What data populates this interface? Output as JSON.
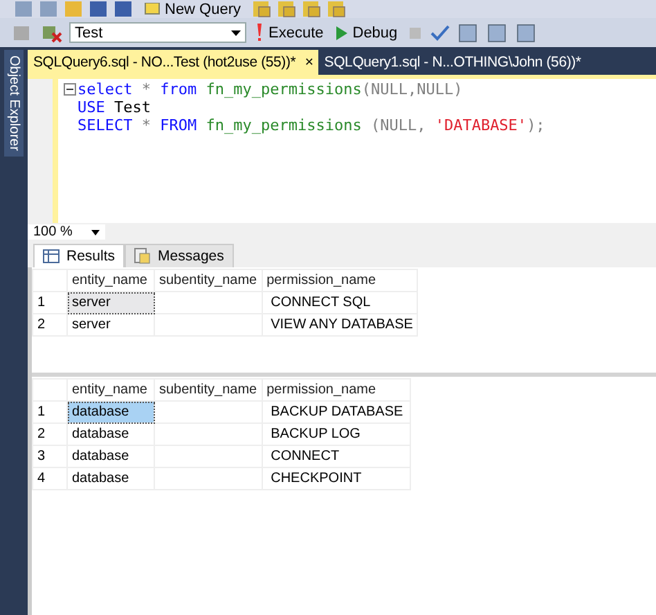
{
  "toolbar_top": {
    "new_query": "New Query"
  },
  "toolbar": {
    "database": "Test",
    "execute": "Execute",
    "debug": "Debug"
  },
  "sidebar": {
    "label": "Object Explorer"
  },
  "tabs": [
    {
      "label": "SQLQuery6.sql - NO...Test (hot2use (55))*",
      "selected": true,
      "close": "×"
    },
    {
      "label": "SQLQuery1.sql - N...OTHING\\John (56))*",
      "selected": false
    }
  ],
  "editor": {
    "lines": [
      [
        {
          "kind": "keyword",
          "text": "select"
        },
        {
          "kind": "operator",
          "text": " * "
        },
        {
          "kind": "keyword",
          "text": "from"
        },
        {
          "kind": "function",
          "text": " fn_my_permissions"
        },
        {
          "kind": "operator",
          "text": "(NULL,NULL)"
        }
      ],
      [
        {
          "kind": "keyword",
          "text": "USE"
        },
        {
          "kind": "plain",
          "text": " Test"
        }
      ],
      [
        {
          "kind": "keyword",
          "text": "SELECT"
        },
        {
          "kind": "operator",
          "text": " * "
        },
        {
          "kind": "keyword",
          "text": "FROM"
        },
        {
          "kind": "function",
          "text": " fn_my_permissions"
        },
        {
          "kind": "operator",
          "text": " (NULL, "
        },
        {
          "kind": "string",
          "text": "'DATABASE'"
        },
        {
          "kind": "operator",
          "text": ");"
        }
      ]
    ]
  },
  "zoom": "100 %",
  "result_tabs": [
    {
      "label": "Results",
      "selected": true
    },
    {
      "label": "Messages",
      "selected": false
    }
  ],
  "grids": [
    {
      "active": false,
      "columns": [
        "entity_name",
        "subentity_name",
        "permission_name"
      ],
      "rows": [
        {
          "number": "1",
          "selected": true,
          "cells": [
            "server",
            "",
            "CONNECT SQL"
          ]
        },
        {
          "number": "2",
          "selected": false,
          "cells": [
            "server",
            "",
            "VIEW ANY DATABASE"
          ]
        }
      ]
    },
    {
      "active": true,
      "columns": [
        "entity_name",
        "subentity_name",
        "permission_name"
      ],
      "rows": [
        {
          "number": "1",
          "selected": true,
          "cells": [
            "database",
            "",
            "BACKUP DATABASE"
          ]
        },
        {
          "number": "2",
          "selected": false,
          "cells": [
            "database",
            "",
            "BACKUP LOG"
          ]
        },
        {
          "number": "3",
          "selected": false,
          "cells": [
            "database",
            "",
            "CONNECT"
          ]
        },
        {
          "number": "4",
          "selected": false,
          "cells": [
            "database",
            "",
            "CHECKPOINT"
          ]
        }
      ]
    }
  ]
}
